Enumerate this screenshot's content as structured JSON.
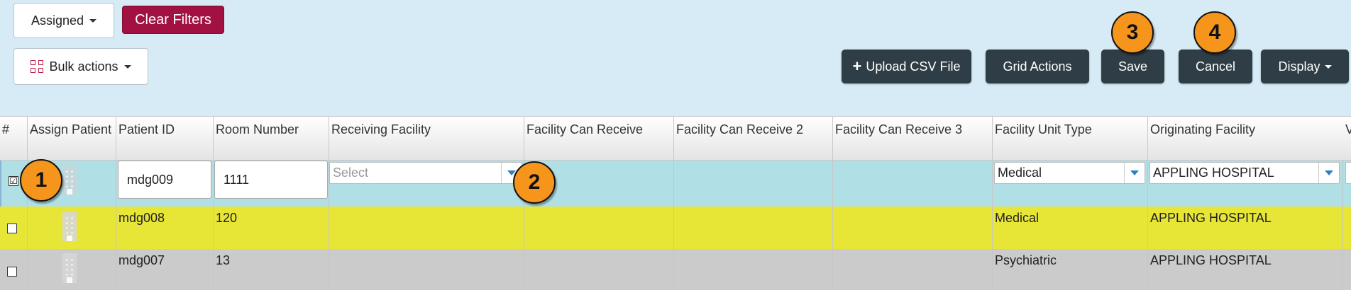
{
  "toolbar": {
    "assigned_label": "Assigned",
    "clear_filters_label": "Clear Filters",
    "bulk_actions_label": "Bulk actions",
    "upload_csv_label": "Upload CSV File",
    "grid_actions_label": "Grid Actions",
    "save_label": "Save",
    "cancel_label": "Cancel",
    "display_label": "Display"
  },
  "callouts": [
    "1",
    "2",
    "3",
    "4"
  ],
  "grid": {
    "columns": [
      "#",
      "Assign Patient",
      "Patient ID",
      "Room Number",
      "Receiving Facility",
      "Facility Can Receive",
      "Facility Can Receive 2",
      "Facility Can Receive 3",
      "Facility Unit Type",
      "Originating Facility",
      "V"
    ],
    "edit_row": {
      "checked": true,
      "checkbox_mark": "☑",
      "patient_id": "mdg009",
      "room_number": "1111",
      "receiving_facility_placeholder": "Select",
      "facility_unit_type": "Medical",
      "originating_facility": "APPLING HOSPITAL"
    },
    "rows": [
      {
        "patient_id": "mdg008",
        "room_number": "120",
        "facility_unit_type": "Medical",
        "originating_facility": "APPLING HOSPITAL",
        "color": "#e7e637"
      },
      {
        "patient_id": "mdg007",
        "room_number": "13",
        "facility_unit_type": "Psychiatric",
        "originating_facility": "APPLING HOSPITAL",
        "color": "#cbcbcb"
      }
    ]
  },
  "colors": {
    "background": "#d6ebf5",
    "clear_filters": "#a11142",
    "dark_button": "#2f3e46",
    "callout": "#f6951b",
    "selected_row": "#b0dfe5"
  },
  "icons": [
    "grid-icon",
    "plus-icon",
    "caret-down-icon",
    "hospital-building-icon",
    "dropdown-arrow-icon",
    "checkbox-icon"
  ]
}
